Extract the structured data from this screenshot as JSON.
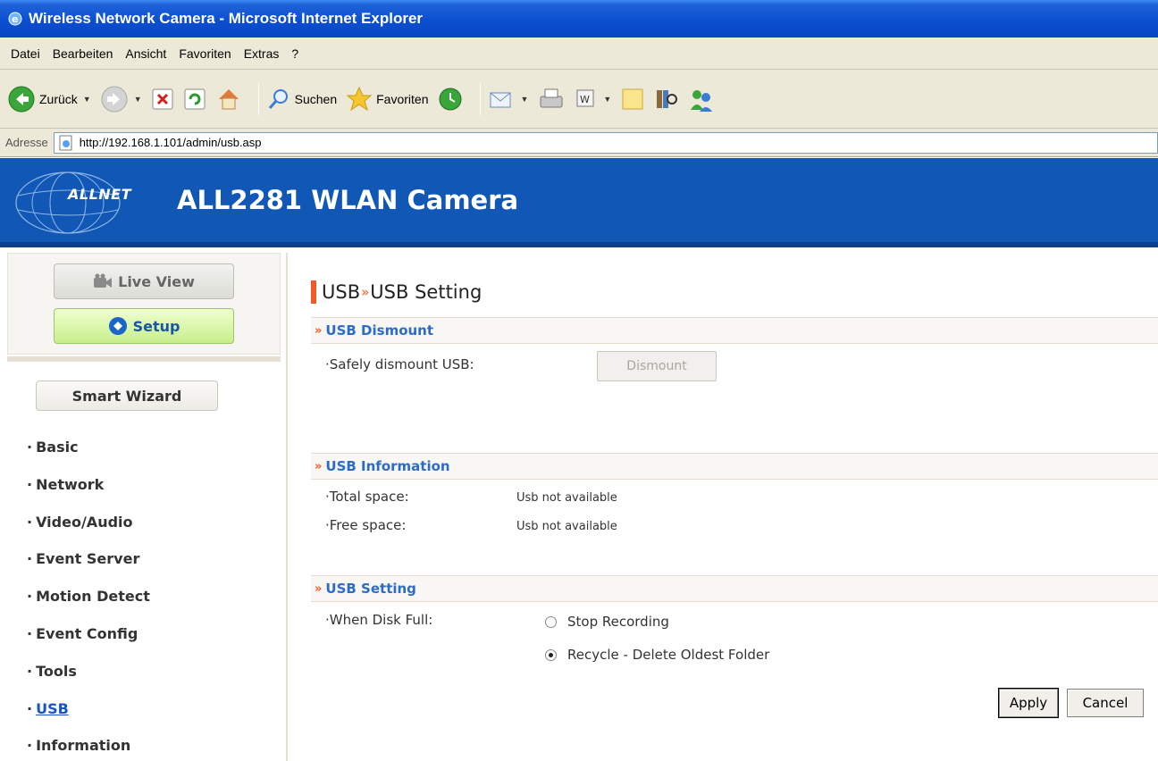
{
  "window": {
    "title": "Wireless Network Camera - Microsoft Internet Explorer"
  },
  "menubar": {
    "items": [
      "Datei",
      "Bearbeiten",
      "Ansicht",
      "Favoriten",
      "Extras",
      "?"
    ]
  },
  "toolbar": {
    "back_label": "Zurück",
    "search_label": "Suchen",
    "favorites_label": "Favoriten"
  },
  "address": {
    "label": "Adresse",
    "url": "http://192.168.1.101/admin/usb.asp"
  },
  "banner": {
    "logo": "ALLNET",
    "product": "ALL2281 WLAN Camera"
  },
  "sidebar": {
    "live_view": "Live View",
    "setup": "Setup",
    "smart_wizard": "Smart Wizard",
    "items": [
      {
        "label": "Basic"
      },
      {
        "label": "Network"
      },
      {
        "label": "Video/Audio"
      },
      {
        "label": "Event Server"
      },
      {
        "label": "Motion Detect"
      },
      {
        "label": "Event Config"
      },
      {
        "label": "Tools"
      },
      {
        "label": "USB"
      },
      {
        "label": "Information"
      }
    ]
  },
  "main": {
    "title_section": "USB",
    "title_page": "USB Setting",
    "dismount": {
      "heading": "USB Dismount",
      "label": "·Safely dismount USB:",
      "button": "Dismount"
    },
    "info": {
      "heading": "USB Information",
      "total_label": "·Total space:",
      "total_value": "Usb not available",
      "free_label": "·Free space:",
      "free_value": "Usb not available"
    },
    "setting": {
      "heading": "USB Setting",
      "label": "·When Disk Full:",
      "option_stop": "Stop Recording",
      "option_recycle": "Recycle - Delete Oldest Folder",
      "selected": "Recycle - Delete Oldest Folder"
    },
    "apply": "Apply",
    "cancel": "Cancel"
  },
  "colors": {
    "banner": "#1157b6",
    "accent": "#ef5a28",
    "link": "#2d6cc6"
  }
}
